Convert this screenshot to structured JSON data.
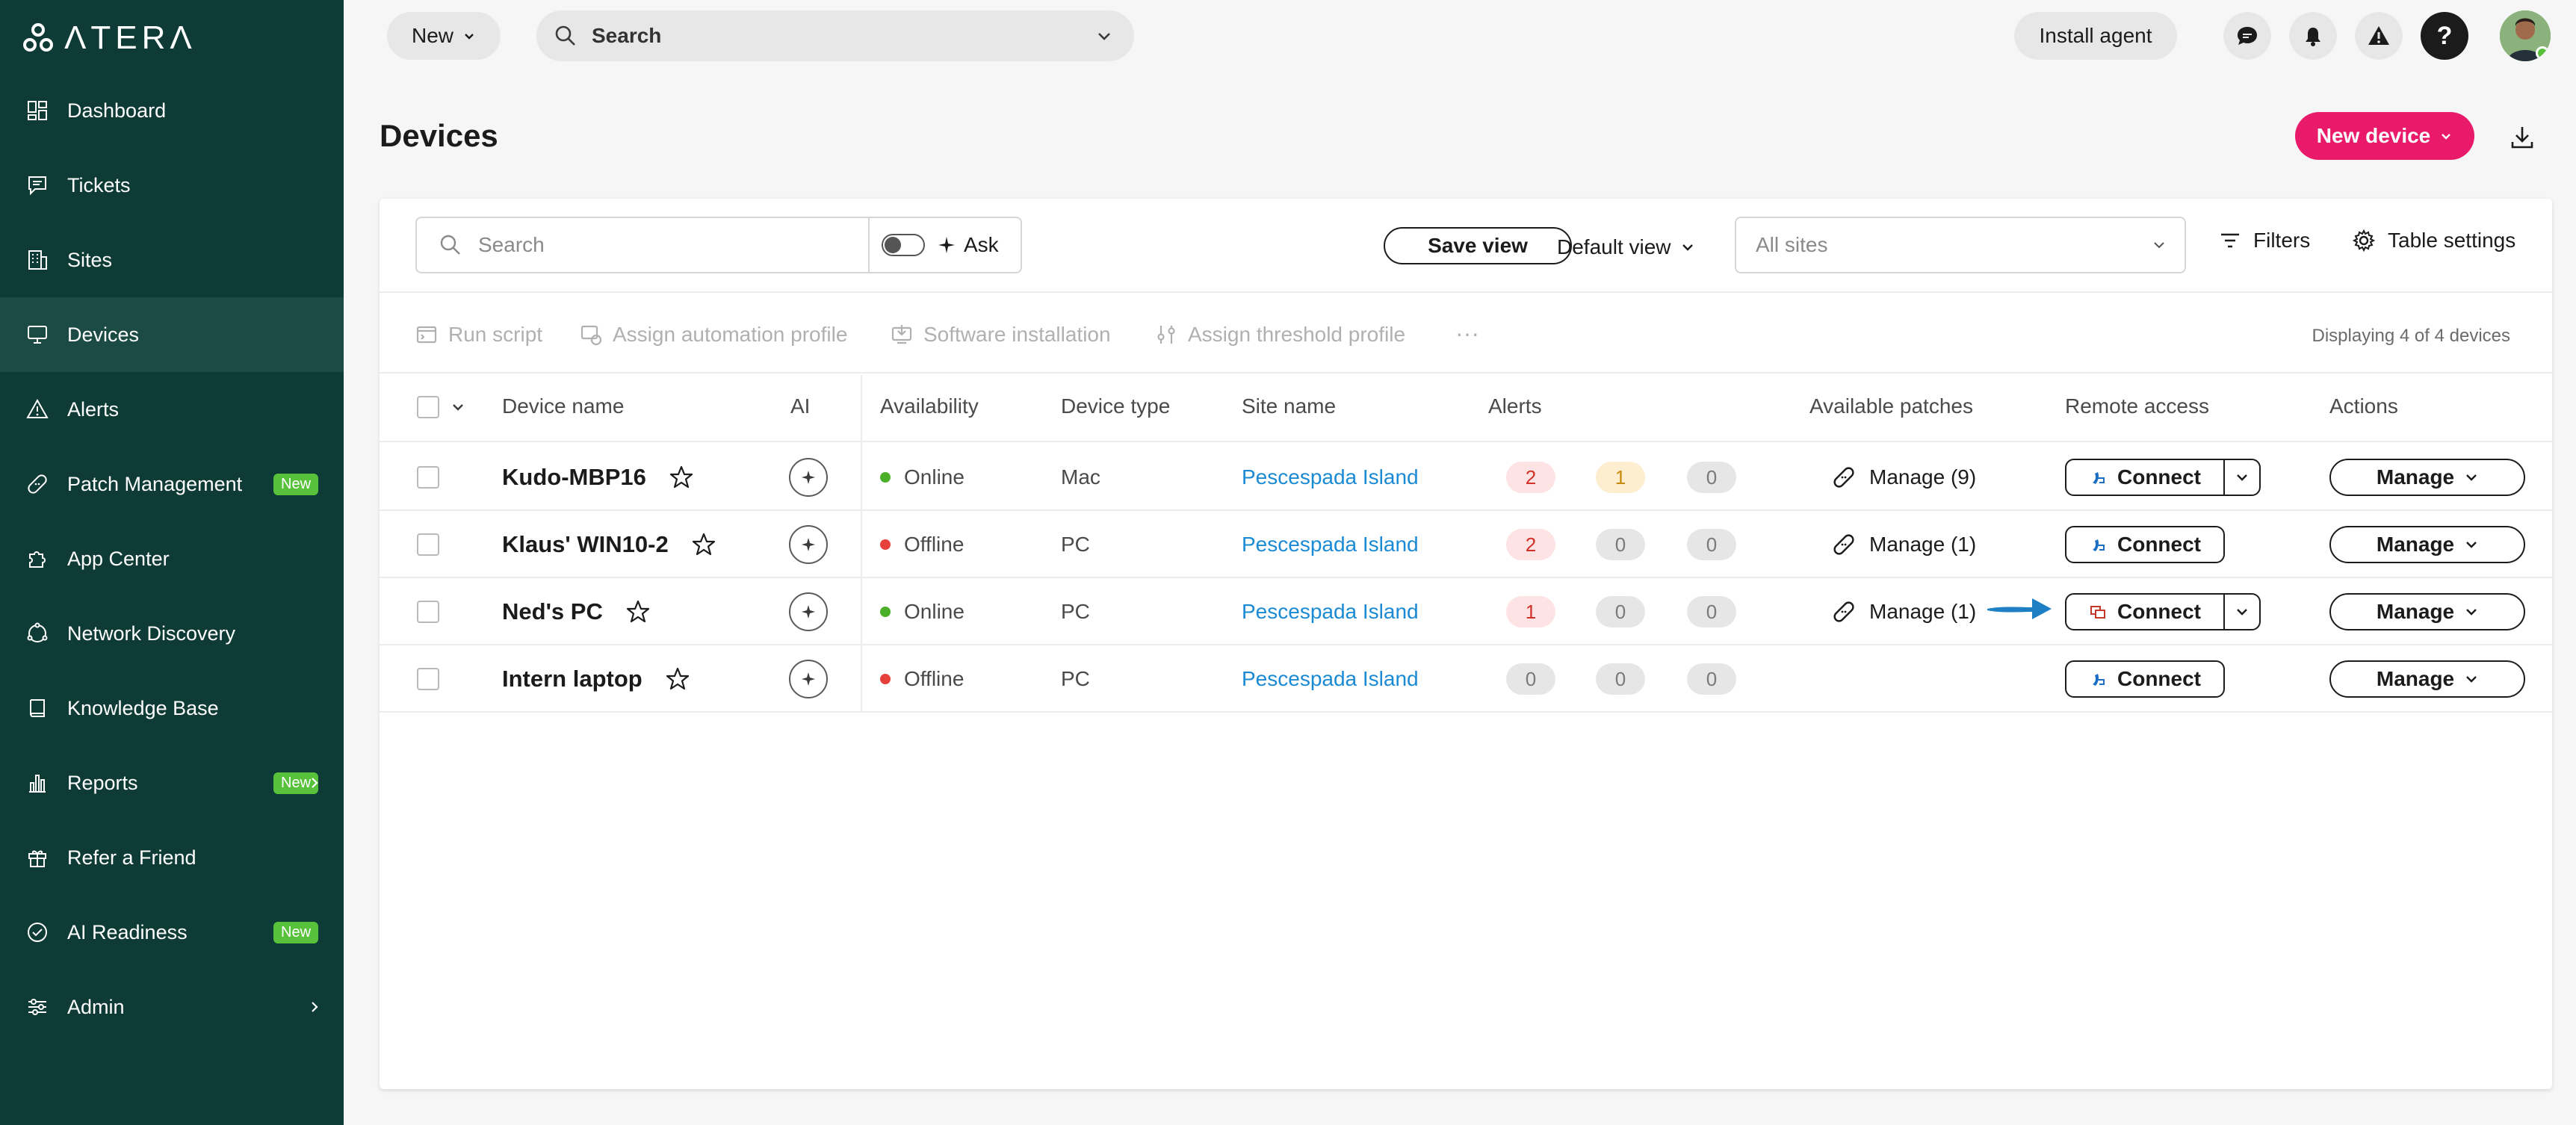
{
  "app": {
    "logo_text": "ΛTERΛ"
  },
  "sidebar": {
    "items": [
      {
        "label": "Dashboard",
        "icon": "dashboard-icon",
        "active": false,
        "badge": "",
        "chevron": false
      },
      {
        "label": "Tickets",
        "icon": "ticket-icon",
        "active": false,
        "badge": "",
        "chevron": false
      },
      {
        "label": "Sites",
        "icon": "building-icon",
        "active": false,
        "badge": "",
        "chevron": false
      },
      {
        "label": "Devices",
        "icon": "monitor-icon",
        "active": true,
        "badge": "",
        "chevron": false
      },
      {
        "label": "Alerts",
        "icon": "warning-icon",
        "active": false,
        "badge": "",
        "chevron": false
      },
      {
        "label": "Patch Management",
        "icon": "patch-icon",
        "active": false,
        "badge": "New",
        "chevron": false
      },
      {
        "label": "App Center",
        "icon": "puzzle-icon",
        "active": false,
        "badge": "",
        "chevron": false
      },
      {
        "label": "Network Discovery",
        "icon": "network-icon",
        "active": false,
        "badge": "",
        "chevron": false
      },
      {
        "label": "Knowledge Base",
        "icon": "book-icon",
        "active": false,
        "badge": "",
        "chevron": false
      },
      {
        "label": "Reports",
        "icon": "chart-icon",
        "active": false,
        "badge": "New",
        "chevron": true
      },
      {
        "label": "Refer a Friend",
        "icon": "gift-icon",
        "active": false,
        "badge": "",
        "chevron": false
      },
      {
        "label": "AI Readiness",
        "icon": "check-circle-icon",
        "active": false,
        "badge": "New",
        "chevron": false
      },
      {
        "label": "Admin",
        "icon": "sliders-icon",
        "active": false,
        "badge": "",
        "chevron": true
      }
    ]
  },
  "topbar": {
    "new_label": "New",
    "search_placeholder": "Search",
    "install_agent_label": "Install agent"
  },
  "page": {
    "title": "Devices",
    "new_device_label": "New device"
  },
  "toolbar": {
    "search_placeholder": "Search",
    "ask_label": "Ask",
    "save_view_label": "Save view",
    "default_view_label": "Default view",
    "sites_placeholder": "All sites",
    "filters_label": "Filters",
    "table_settings_label": "Table settings"
  },
  "bulk_actions": {
    "run_script": "Run script",
    "assign_automation": "Assign automation profile",
    "software_installation": "Software installation",
    "assign_threshold": "Assign threshold profile",
    "more": "···",
    "displaying": "Displaying 4 of 4 devices"
  },
  "table": {
    "columns": {
      "device_name": "Device name",
      "ai": "AI",
      "availability": "Availability",
      "device_type": "Device type",
      "site_name": "Site name",
      "alerts": "Alerts",
      "patches": "Available patches",
      "remote_access": "Remote access",
      "actions": "Actions"
    },
    "rows": [
      {
        "name": "Kudo-MBP16",
        "availability": "Online",
        "status_color": "#4caf2a",
        "type": "Mac",
        "site": "Pescespada Island",
        "alerts": [
          "2",
          "1",
          "0"
        ],
        "alert_styles": [
          "red",
          "orange",
          "grey"
        ],
        "patches": "Manage (9)",
        "connect": "Connect",
        "connect_split": true,
        "connect_icon": "remote-icon",
        "manage": "Manage"
      },
      {
        "name": "Klaus' WIN10-2",
        "availability": "Offline",
        "status_color": "#e5403a",
        "type": "PC",
        "site": "Pescespada Island",
        "alerts": [
          "2",
          "0",
          "0"
        ],
        "alert_styles": [
          "red",
          "grey",
          "grey"
        ],
        "patches": "Manage (1)",
        "connect": "Connect",
        "connect_split": false,
        "connect_icon": "remote-icon",
        "manage": "Manage"
      },
      {
        "name": "Ned's PC",
        "availability": "Online",
        "status_color": "#4caf2a",
        "type": "PC",
        "site": "Pescespada Island",
        "alerts": [
          "1",
          "0",
          "0"
        ],
        "alert_styles": [
          "red",
          "grey",
          "grey"
        ],
        "patches": "Manage (1)",
        "connect": "Connect",
        "connect_split": true,
        "connect_icon": "rdp-icon",
        "manage": "Manage"
      },
      {
        "name": "Intern laptop",
        "availability": "Offline",
        "status_color": "#e5403a",
        "type": "PC",
        "site": "Pescespada Island",
        "alerts": [
          "0",
          "0",
          "0"
        ],
        "alert_styles": [
          "grey",
          "grey",
          "grey"
        ],
        "patches": "",
        "connect": "Connect",
        "connect_split": false,
        "connect_icon": "remote-icon",
        "manage": "Manage"
      }
    ]
  },
  "colors": {
    "sidebar_bg": "#0e3b35",
    "accent": "#ea1a6b",
    "link": "#1a8ad4",
    "badge_new": "#58c13b",
    "arrow": "#1e7fc4"
  }
}
